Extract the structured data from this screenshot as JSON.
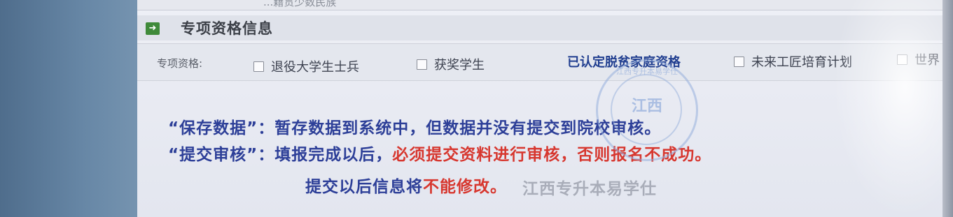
{
  "top_strip": {
    "text": "...籍贯少数民族"
  },
  "section": {
    "icon": "arrow-right-icon",
    "title": "专项资格信息"
  },
  "qualifications": {
    "label": "专项资格:",
    "options": [
      {
        "label": "退役大学生士兵",
        "checked": false
      },
      {
        "label": "获奖学生",
        "checked": false
      },
      {
        "label": "未来工匠培育计划",
        "checked": false
      },
      {
        "label": "世界",
        "checked": false
      }
    ],
    "certified_text": "已认定脱贫家庭资格"
  },
  "notice": {
    "line1": "“保存数据”：暂存数据到系统中，但数据并没有提交到院校审核。",
    "line2_a": "“提交审核”：填报完成以后，",
    "line2_b": "必须提交资料进行审核，否则报名不成功。",
    "line3_a": "提交以后信息将",
    "line3_b": "不能修改。"
  },
  "watermark": {
    "text": "江西专升本易学仕",
    "stamp_ring": "江西专升本易学仕",
    "stamp_center": "江西"
  },
  "colors": {
    "blue_text": "#2d3f98",
    "red_text": "#d7372f",
    "icon_green": "#3f8a3a"
  }
}
